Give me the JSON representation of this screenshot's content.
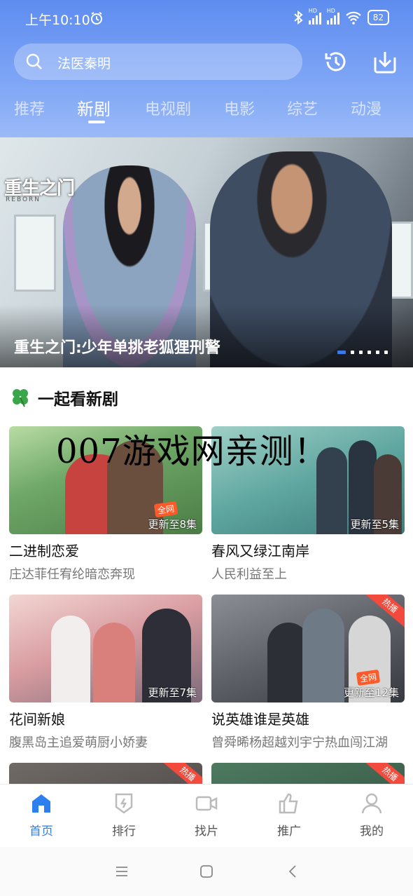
{
  "status_bar": {
    "time": "上午10:10",
    "network_1": "HD",
    "network_2": "HD",
    "battery": "82"
  },
  "header": {
    "search_text": "法医秦明",
    "tabs": [
      "推荐",
      "新剧",
      "电视剧",
      "电影",
      "综艺",
      "动漫"
    ],
    "active_tab": "新剧"
  },
  "banner": {
    "logo_text": "重生之门",
    "logo_sub": "REBORN",
    "caption": "重生之门:少年单挑老狐狸刑警",
    "slide_count": 6,
    "active_slide": 1
  },
  "section": {
    "title": "一起看新剧"
  },
  "cards": [
    {
      "name": "二进制恋爱",
      "desc": "庄达菲任宥纶暗恋奔现",
      "update": "更新至8集",
      "tag": "全网",
      "hot": ""
    },
    {
      "name": "春风又绿江南岸",
      "desc": "人民利益至上",
      "update": "更新至5集",
      "tag": "",
      "hot": ""
    },
    {
      "name": "花间新娘",
      "desc": "腹黑岛主追爱萌厨小娇妻",
      "update": "更新至7集",
      "tag": "",
      "hot": ""
    },
    {
      "name": "说英雄谁是英雄",
      "desc": "曾舜晞杨超越刘宇宁热血闯江湖",
      "update": "更新至12集",
      "tag": "全网",
      "hot": "热播"
    },
    {
      "name": "",
      "desc": "",
      "update": "",
      "tag": "",
      "hot": "热播"
    },
    {
      "name": "",
      "desc": "",
      "update": "",
      "tag": "",
      "hot": "热播"
    }
  ],
  "watermark": "007游戏网亲测！",
  "bottom_nav": [
    {
      "label": "首页",
      "icon": "home-icon",
      "active": true
    },
    {
      "label": "排行",
      "icon": "ranking-icon",
      "active": false
    },
    {
      "label": "找片",
      "icon": "video-camera-icon",
      "active": false
    },
    {
      "label": "推广",
      "icon": "thumbs-up-icon",
      "active": false
    },
    {
      "label": "我的",
      "icon": "user-icon",
      "active": false
    }
  ],
  "colors": {
    "accent": "#2d7ff0",
    "header_top": "#5e8df0",
    "hot_badge": "#f24a3c"
  }
}
